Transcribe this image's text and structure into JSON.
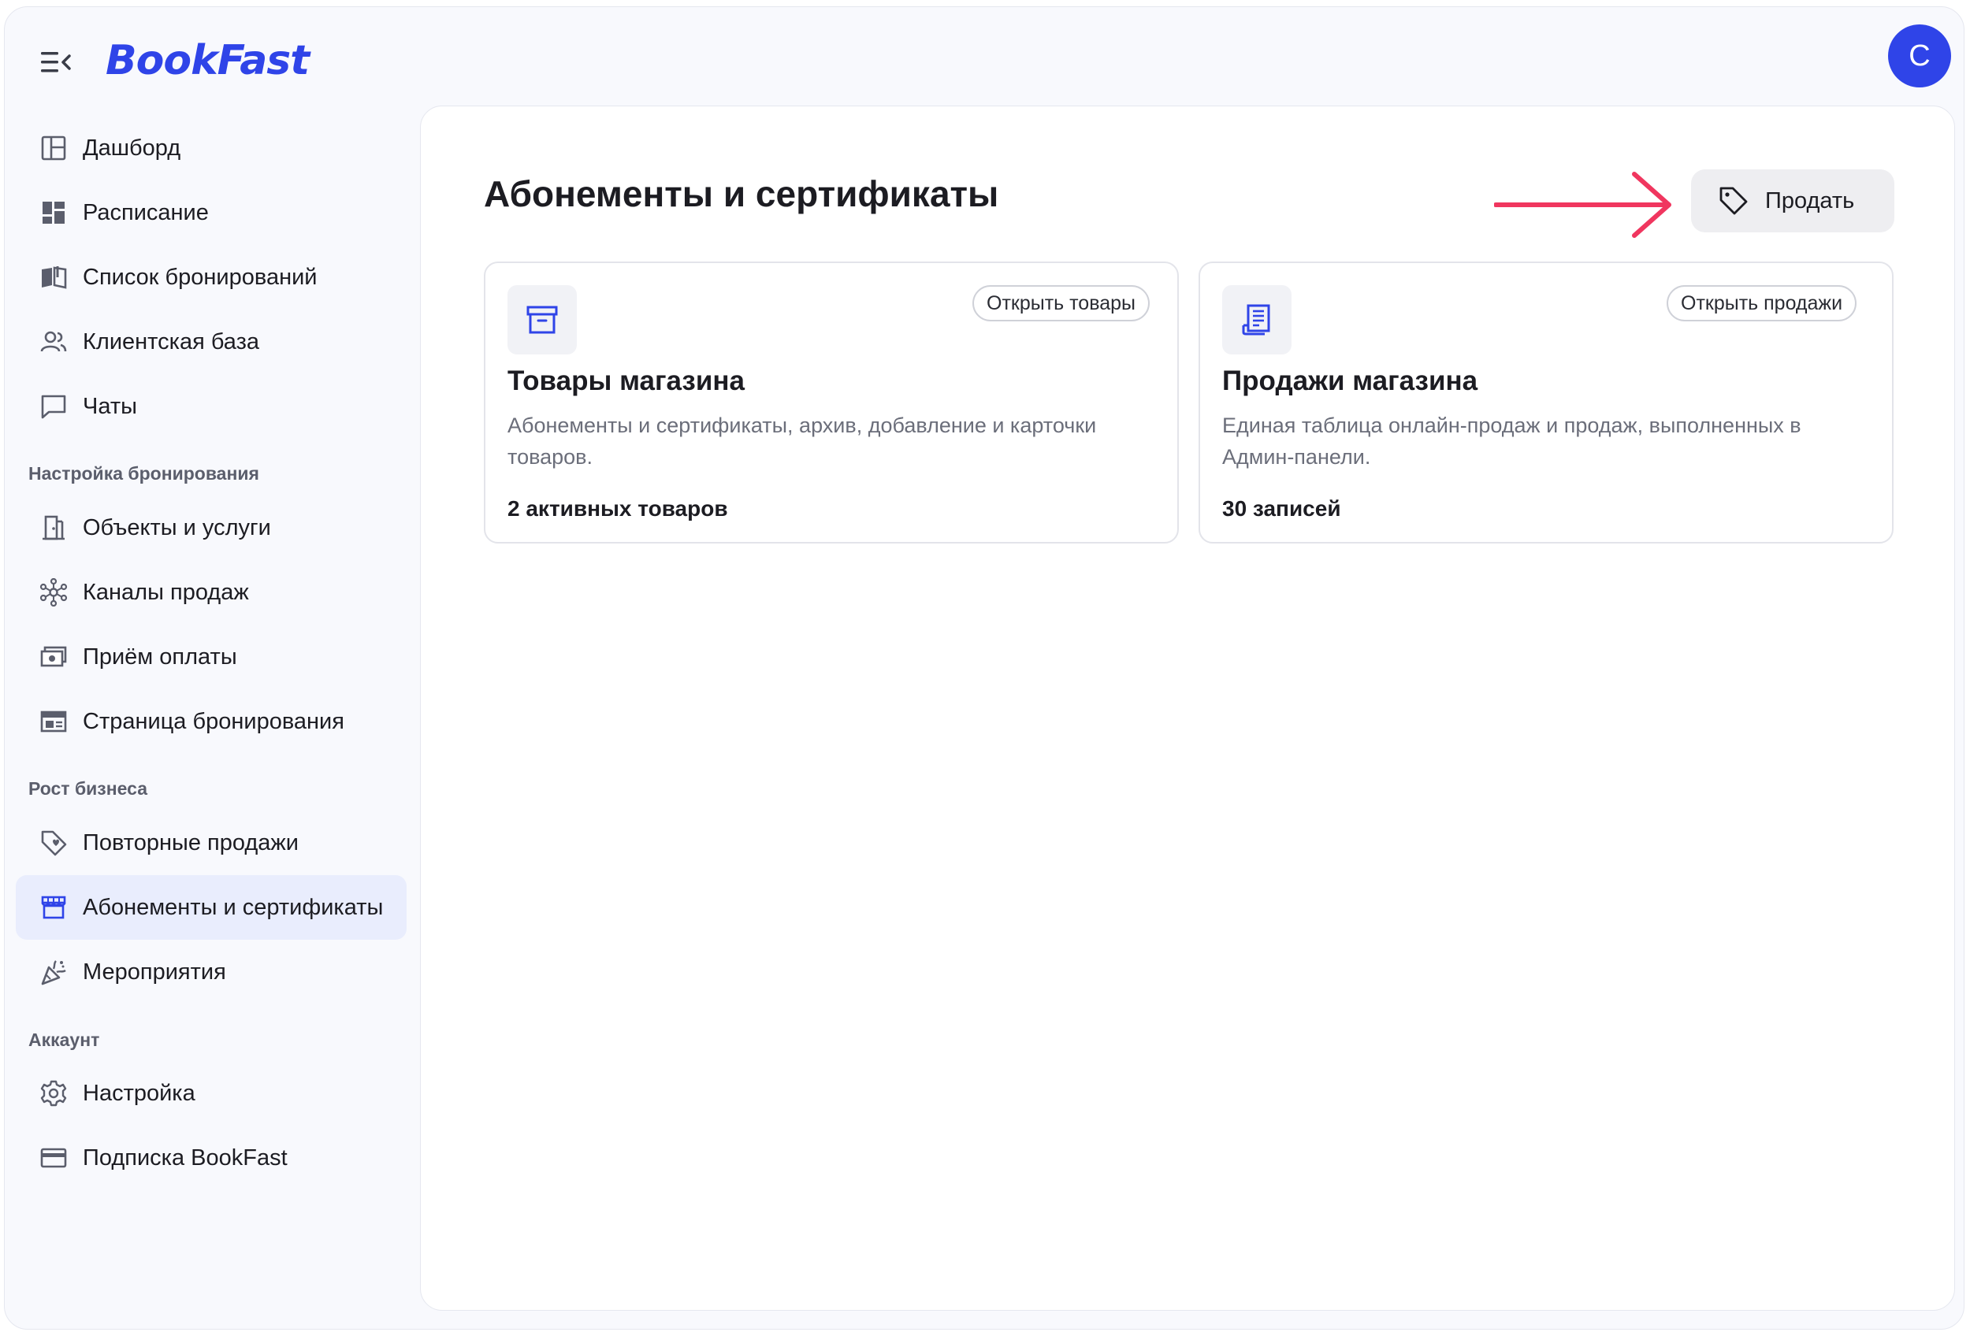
{
  "app": {
    "logo_text": "BookFast",
    "avatar_initial": "C"
  },
  "sidebar": {
    "items": [
      {
        "label": "Дашборд",
        "icon": "dashboard-icon"
      },
      {
        "label": "Расписание",
        "icon": "schedule-icon"
      },
      {
        "label": "Список бронирований",
        "icon": "book-icon"
      },
      {
        "label": "Клиентская база",
        "icon": "users-icon"
      },
      {
        "label": "Чаты",
        "icon": "chat-icon"
      }
    ],
    "section_booking": "Настройка бронирования",
    "booking_items": [
      {
        "label": "Объекты и услуги",
        "icon": "door-icon"
      },
      {
        "label": "Каналы продаж",
        "icon": "network-icon"
      },
      {
        "label": "Приём оплаты",
        "icon": "payment-icon"
      },
      {
        "label": "Страница бронирования",
        "icon": "page-icon"
      }
    ],
    "section_growth": "Рост бизнеса",
    "growth_items": [
      {
        "label": "Повторные продажи",
        "icon": "tag-heart-icon"
      },
      {
        "label": "Абонементы и сертификаты",
        "icon": "store-icon",
        "active": true
      },
      {
        "label": "Мероприятия",
        "icon": "party-icon"
      }
    ],
    "section_account": "Аккаунт",
    "account_items": [
      {
        "label": "Настройка",
        "icon": "gear-icon"
      },
      {
        "label": "Подписка BookFast",
        "icon": "card-icon"
      }
    ]
  },
  "main": {
    "title": "Абонементы и сертификаты",
    "sell_button": "Продать",
    "cards": [
      {
        "title": "Товары магазина",
        "pill": "Открыть товары",
        "description": "Абонементы и сертификаты, архив, добавление и карточки товаров.",
        "count": "2 активных товаров",
        "icon": "archive-box-icon"
      },
      {
        "title": "Продажи магазина",
        "pill": "Открыть продажи",
        "description": "Единая таблица онлайн-продаж и продаж, выполненных в Админ-панели.",
        "count": "30 записей",
        "icon": "receipt-icon"
      }
    ]
  },
  "colors": {
    "accent": "#2f44e8",
    "annotation_arrow": "#f0365f",
    "active_bg": "#e9edfd"
  }
}
